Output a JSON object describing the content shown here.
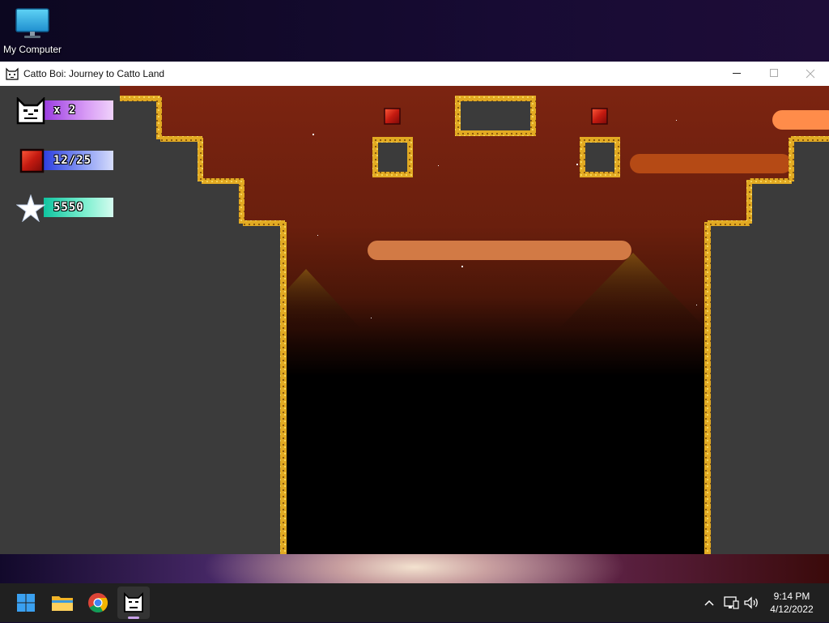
{
  "desktop": {
    "icons": [
      {
        "label": "My Computer",
        "icon": "monitor-icon"
      }
    ]
  },
  "window": {
    "title": "Catto Boi: Journey to Catto Land",
    "app_icon": "cat-face-icon",
    "controls": {
      "minimize": "minimize-icon",
      "maximize": "maximize-icon",
      "close": "close-icon"
    }
  },
  "hud": {
    "lives": {
      "text": "x 2",
      "icon": "cat-face-icon"
    },
    "gems": {
      "text": "12/25",
      "icon": "red-gem-icon"
    },
    "score": {
      "text": "5550",
      "icon": "star-icon"
    }
  },
  "scene": {
    "colors": {
      "sky_top": "#7a2210",
      "sky_mid": "#5a1a08",
      "wall": "#3b3b3b",
      "grass": "#e0a820",
      "cloud": "#d8793f",
      "cloud_bright": "#ff8c4a",
      "pit": "#000000"
    },
    "collectibles": [
      "red-gem",
      "red-gem"
    ]
  },
  "taskbar": {
    "items": [
      {
        "name": "start",
        "icon": "windows-logo-icon"
      },
      {
        "name": "file-explorer",
        "icon": "folder-icon"
      },
      {
        "name": "chrome",
        "icon": "chrome-icon"
      },
      {
        "name": "catto-boi",
        "icon": "cat-face-icon",
        "active": true
      }
    ],
    "tray": {
      "chevron": "chevron-up-icon",
      "network": "network-icon",
      "volume": "volume-icon"
    },
    "clock": {
      "time": "9:14 PM",
      "date": "4/12/2022"
    }
  }
}
